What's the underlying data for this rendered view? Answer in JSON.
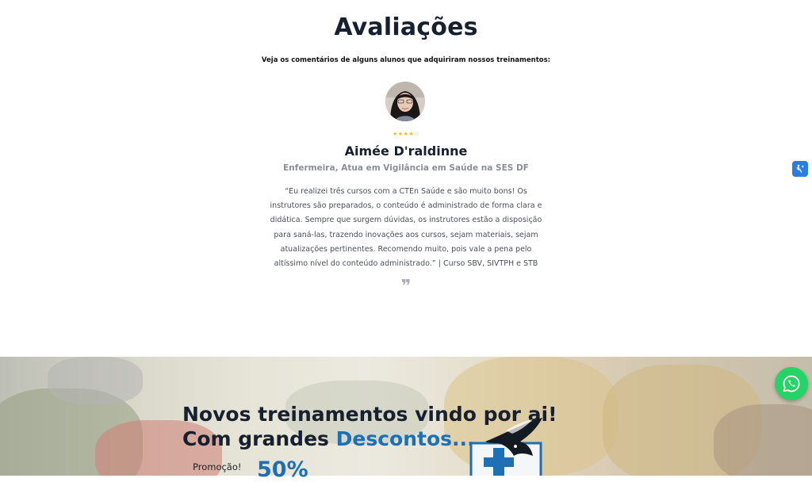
{
  "reviews": {
    "title": "Avaliações",
    "subtitle": "Veja os comentários de alguns alunos que adquiriram nossos treinamentos:",
    "rating": 4,
    "rating_max": 5,
    "stars_text": "★★★★☆",
    "name": "Aimée D'raldinne",
    "role": "Enfermeira, Atua em Vigilância em Saúde na SES DF",
    "quote_lines": [
      "“Eu realizei três cursos com a CTEn Saúde e são muito bons! Os",
      "instrutores são preparados, o conteúdo é administrado de forma clara e",
      "didática. Sempre que surgem dúvidas, os instrutores estão a disposição",
      "para saná-las, trazendo inovações aos cursos, sejam materiais, sejam",
      "atualizações pertinentes. Recomendo muito, pois vale a pena pelo",
      "altíssimo nível do conteúdo administrado.” | Curso SBV, SIVTPH e STB"
    ],
    "quote_mark": "❞"
  },
  "promo": {
    "line1": "Novos treinamentos vindo por ai!",
    "line2_prefix": "Com grandes ",
    "line2_highlight": "Descontos...",
    "promo_label": "Promoção!",
    "percent": "50%"
  },
  "colors": {
    "heading": "#16202e",
    "accent_blue": "#1f6fb5",
    "star": "#f2c200",
    "whatsapp": "#25d366",
    "accessibility": "#2a7de1"
  },
  "icons": {
    "accessibility": "accessibility-icon",
    "whatsapp": "whatsapp-icon",
    "quote": "quote-icon"
  }
}
